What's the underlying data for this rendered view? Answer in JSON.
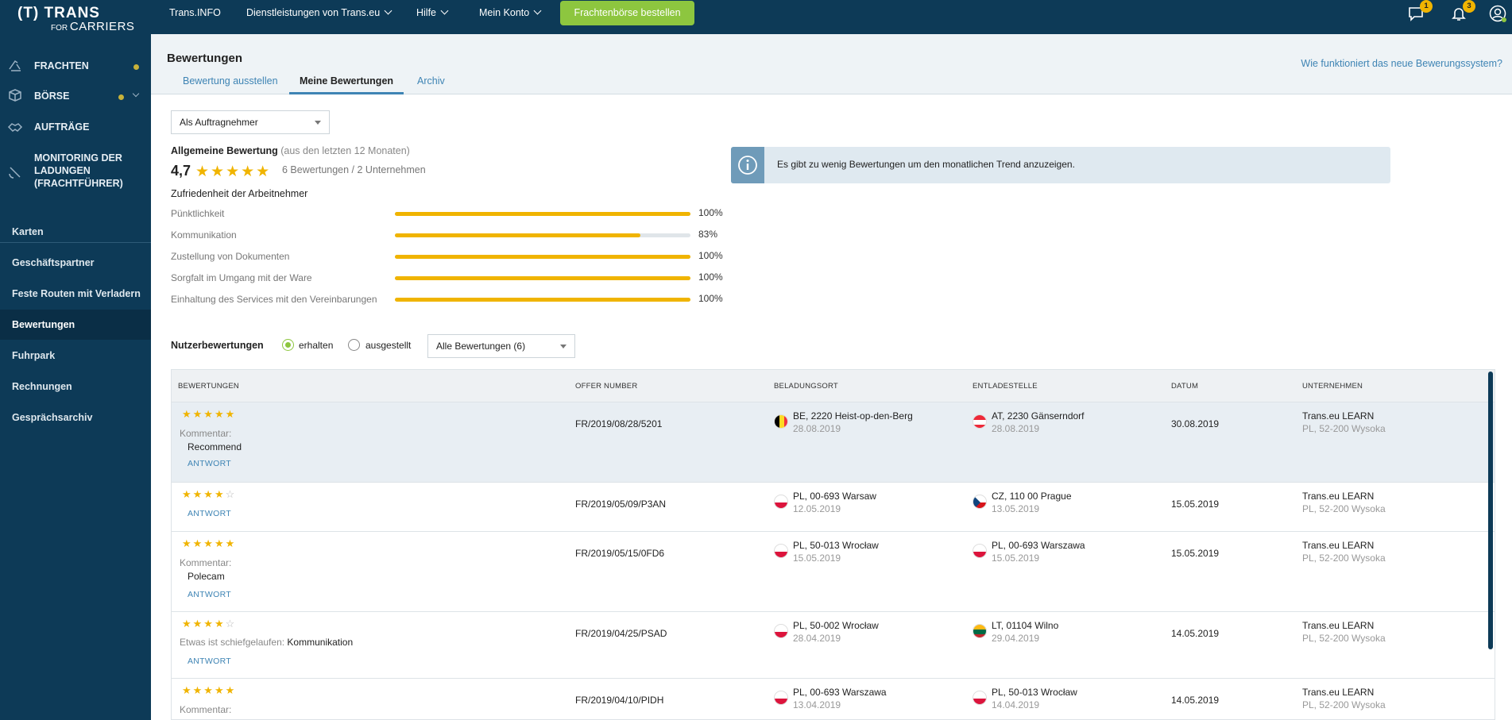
{
  "logo": {
    "line1": "(T) TRANS",
    "line2a": "FOR",
    "line2b": "CARRIERS"
  },
  "topnav": {
    "items": [
      "Trans.INFO",
      "Dienstleistungen von Trans.eu",
      "Hilfe",
      "Mein Konto"
    ],
    "order_button": "Frachtenbörse bestellen",
    "messages_badge": "1",
    "notifications_badge": "3"
  },
  "sidebar": {
    "main": [
      "FRACHTEN",
      "BÖRSE",
      "AUFTRÄGE",
      "MONITORING DER LADUNGEN (FRACHTFÜHRER)"
    ],
    "sub": [
      "Karten",
      "Geschäftspartner",
      "Feste Routen mit Verladern",
      "Bewertungen",
      "Fuhrpark",
      "Rechnungen",
      "Gesprächsarchiv"
    ],
    "active": "Bewertungen"
  },
  "header": {
    "title": "Bewertungen",
    "tabs": [
      "Bewertung ausstellen",
      "Meine Bewertungen",
      "Archiv"
    ],
    "active_tab": "Meine Bewertungen",
    "help_link": "Wie funktioniert das neue Bewerungssystem?"
  },
  "role_select": "Als Auftragnehmer",
  "overall": {
    "title": "Allgemeine Bewertung",
    "subtitle": "(aus den letzten 12 Monaten)",
    "score": "4,7",
    "stars": "★★★★★",
    "count": "6 Bewertungen / 2 Unternehmen"
  },
  "satisfaction": {
    "title": "Zufriedenheit der Arbeitnehmer",
    "criteria": [
      {
        "label": "Pünktlichkeit",
        "value": 100,
        "pct": "100%"
      },
      {
        "label": "Kommunikation",
        "value": 83,
        "pct": "83%"
      },
      {
        "label": "Zustellung von Dokumenten",
        "value": 100,
        "pct": "100%"
      },
      {
        "label": "Sorgfalt im Umgang mit der Ware",
        "value": 100,
        "pct": "100%"
      },
      {
        "label": "Einhaltung des Services mit den Vereinbarungen",
        "value": 100,
        "pct": "100%"
      }
    ]
  },
  "trend_info": "Es gibt zu wenig Bewertungen um den monatlichen Trend anzuzeigen.",
  "user_reviews": {
    "label": "Nutzerbewertungen",
    "radio_received": "erhalten",
    "radio_issued": "ausgestellt",
    "filter": "Alle Bewertungen (6)"
  },
  "table": {
    "headers": [
      "BEWERTUNGEN",
      "OFFER NUMBER",
      "BELADUNGSORT",
      "ENTLADESTELLE",
      "DATUM",
      "UNTERNEHMEN"
    ],
    "rows": [
      {
        "stars": "★★★★★",
        "empty": "",
        "comment_label": "Kommentar:",
        "comment": "Recommend",
        "answer": "ANTWORT",
        "offer": "FR/2019/08/28/5201",
        "load": "BE, 2220 Heist-op-den-Berg",
        "load_date": "28.08.2019",
        "load_flag": "be",
        "unload": "AT, 2230 Gänserndorf",
        "unload_date": "28.08.2019",
        "unload_flag": "at",
        "date": "30.08.2019",
        "company": "Trans.eu LEARN",
        "company_sub": "PL, 52-200 Wysoka"
      },
      {
        "stars": "★★★★",
        "empty": "☆",
        "answer": "ANTWORT",
        "offer": "FR/2019/05/09/P3AN",
        "load": "PL, 00-693 Warsaw",
        "load_date": "12.05.2019",
        "load_flag": "pl",
        "unload": "CZ, 110 00 Prague",
        "unload_date": "13.05.2019",
        "unload_flag": "cz",
        "date": "15.05.2019",
        "company": "Trans.eu LEARN",
        "company_sub": "PL, 52-200 Wysoka"
      },
      {
        "stars": "★★★★★",
        "empty": "",
        "comment_label": "Kommentar:",
        "comment": "Polecam",
        "answer": "ANTWORT",
        "offer": "FR/2019/05/15/0FD6",
        "load": "PL, 50-013 Wrocław",
        "load_date": "15.05.2019",
        "load_flag": "pl",
        "unload": "PL, 00-693 Warszawa",
        "unload_date": "15.05.2019",
        "unload_flag": "pl",
        "date": "15.05.2019",
        "company": "Trans.eu LEARN",
        "company_sub": "PL, 52-200 Wysoka"
      },
      {
        "stars": "★★★★",
        "empty": "☆",
        "issue_label": "Etwas ist schiefgelaufen:",
        "issue": "Kommunikation",
        "answer": "ANTWORT",
        "offer": "FR/2019/04/25/PSAD",
        "load": "PL, 50-002 Wrocław",
        "load_date": "28.04.2019",
        "load_flag": "pl",
        "unload": "LT, 01104 Wilno",
        "unload_date": "29.04.2019",
        "unload_flag": "lt",
        "date": "14.05.2019",
        "company": "Trans.eu LEARN",
        "company_sub": "PL, 52-200 Wysoka"
      },
      {
        "stars": "★★★★★",
        "empty": "",
        "comment_label": "Kommentar:",
        "offer": "FR/2019/04/10/PIDH",
        "load": "PL, 00-693 Warszawa",
        "load_date": "13.04.2019",
        "load_flag": "pl",
        "unload": "PL, 50-013 Wrocław",
        "unload_date": "14.04.2019",
        "unload_flag": "pl",
        "date": "14.05.2019",
        "company": "Trans.eu LEARN",
        "company_sub": "PL, 52-200 Wysoka"
      }
    ]
  },
  "colors": {
    "navy": "#0d3a57",
    "accent_green": "#8dc63f",
    "star": "#f0b400",
    "link": "#3e84b4"
  }
}
